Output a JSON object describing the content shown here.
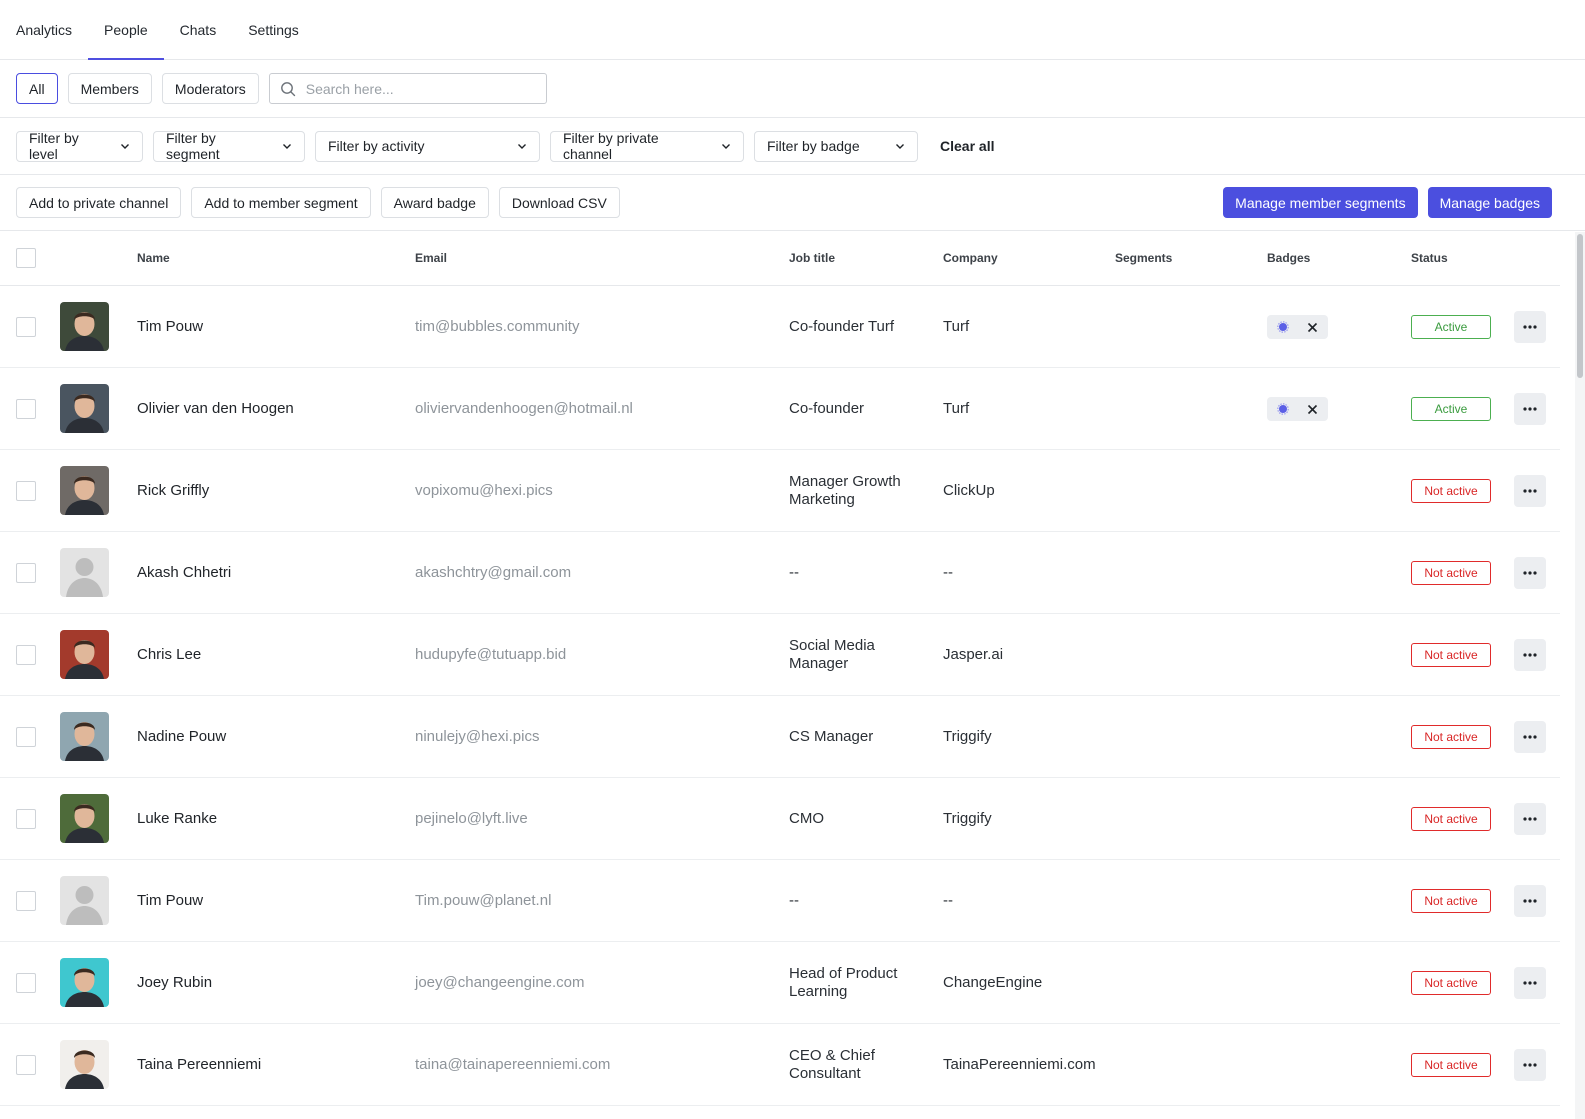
{
  "nav": {
    "tabs": [
      {
        "label": "Analytics"
      },
      {
        "label": "People"
      },
      {
        "label": "Chats"
      },
      {
        "label": "Settings"
      }
    ],
    "active": "People"
  },
  "segments": {
    "items": [
      {
        "label": "All"
      },
      {
        "label": "Members"
      },
      {
        "label": "Moderators"
      }
    ],
    "active": "All"
  },
  "search": {
    "placeholder": "Search here...",
    "value": ""
  },
  "filters": {
    "level": "Filter by level",
    "segment": "Filter by segment",
    "activity": "Filter by activity",
    "private_channel": "Filter by private channel",
    "badge": "Filter by badge",
    "clear": "Clear all"
  },
  "actions": {
    "add_private": "Add to private channel",
    "add_segment": "Add to member segment",
    "award_badge": "Award badge",
    "download_csv": "Download CSV",
    "manage_segments": "Manage member segments",
    "manage_badges": "Manage badges"
  },
  "table": {
    "headers": {
      "name": "Name",
      "email": "Email",
      "job": "Job title",
      "company": "Company",
      "segments": "Segments",
      "badges": "Badges",
      "status": "Status"
    },
    "rows": [
      {
        "name": "Tim Pouw",
        "email": "tim@bubbles.community",
        "job": "Co-founder Turf",
        "company": "Turf",
        "badge": true,
        "status": "Active",
        "avatar": "photo",
        "avatar_color": "#3e4a3a"
      },
      {
        "name": "Olivier van den Hoogen",
        "email": "oliviervandenhoogen@hotmail.nl",
        "job": "Co-founder",
        "company": "Turf",
        "badge": true,
        "status": "Active",
        "avatar": "photo",
        "avatar_color": "#4a5560"
      },
      {
        "name": "Rick Griffly",
        "email": "vopixomu@hexi.pics",
        "job": "Manager Growth Marketing",
        "company": "ClickUp",
        "badge": false,
        "status": "Not active",
        "avatar": "photo",
        "avatar_color": "#6f6a66"
      },
      {
        "name": "Akash Chhetri",
        "email": "akashchtry@gmail.com",
        "job": "--",
        "company": "--",
        "badge": false,
        "status": "Not active",
        "avatar": "placeholder",
        "avatar_color": "#dcdcdc"
      },
      {
        "name": "Chris Lee",
        "email": "hudupyfe@tutuapp.bid",
        "job": "Social Media Manager",
        "company": "Jasper.ai",
        "badge": false,
        "status": "Not active",
        "avatar": "photo",
        "avatar_color": "#a33a2c"
      },
      {
        "name": "Nadine Pouw",
        "email": "ninulejy@hexi.pics",
        "job": "CS Manager",
        "company": "Triggify",
        "badge": false,
        "status": "Not active",
        "avatar": "photo",
        "avatar_color": "#8fa6b0"
      },
      {
        "name": "Luke Ranke",
        "email": "pejinelo@lyft.live",
        "job": "CMO",
        "company": "Triggify",
        "badge": false,
        "status": "Not active",
        "avatar": "photo",
        "avatar_color": "#4e6b3a"
      },
      {
        "name": "Tim Pouw",
        "email": "Tim.pouw@planet.nl",
        "job": "--",
        "company": "--",
        "badge": false,
        "status": "Not active",
        "avatar": "placeholder",
        "avatar_color": "#dcdcdc"
      },
      {
        "name": "Joey Rubin",
        "email": "joey@changeengine.com",
        "job": "Head of Product Learning",
        "company": "ChangeEngine",
        "badge": false,
        "status": "Not active",
        "avatar": "photo",
        "avatar_color": "#3fc7cf"
      },
      {
        "name": "Taina Pereenniemi",
        "email": "taina@tainapereenniemi.com",
        "job": "CEO & Chief Consultant",
        "company": "TainaPereenniemi.com",
        "badge": false,
        "status": "Not active",
        "avatar": "photo",
        "avatar_color": "#f1efec"
      }
    ]
  },
  "colors": {
    "accent": "#4b4fdf",
    "active": "#3a9b3e",
    "inactive": "#d92626"
  }
}
